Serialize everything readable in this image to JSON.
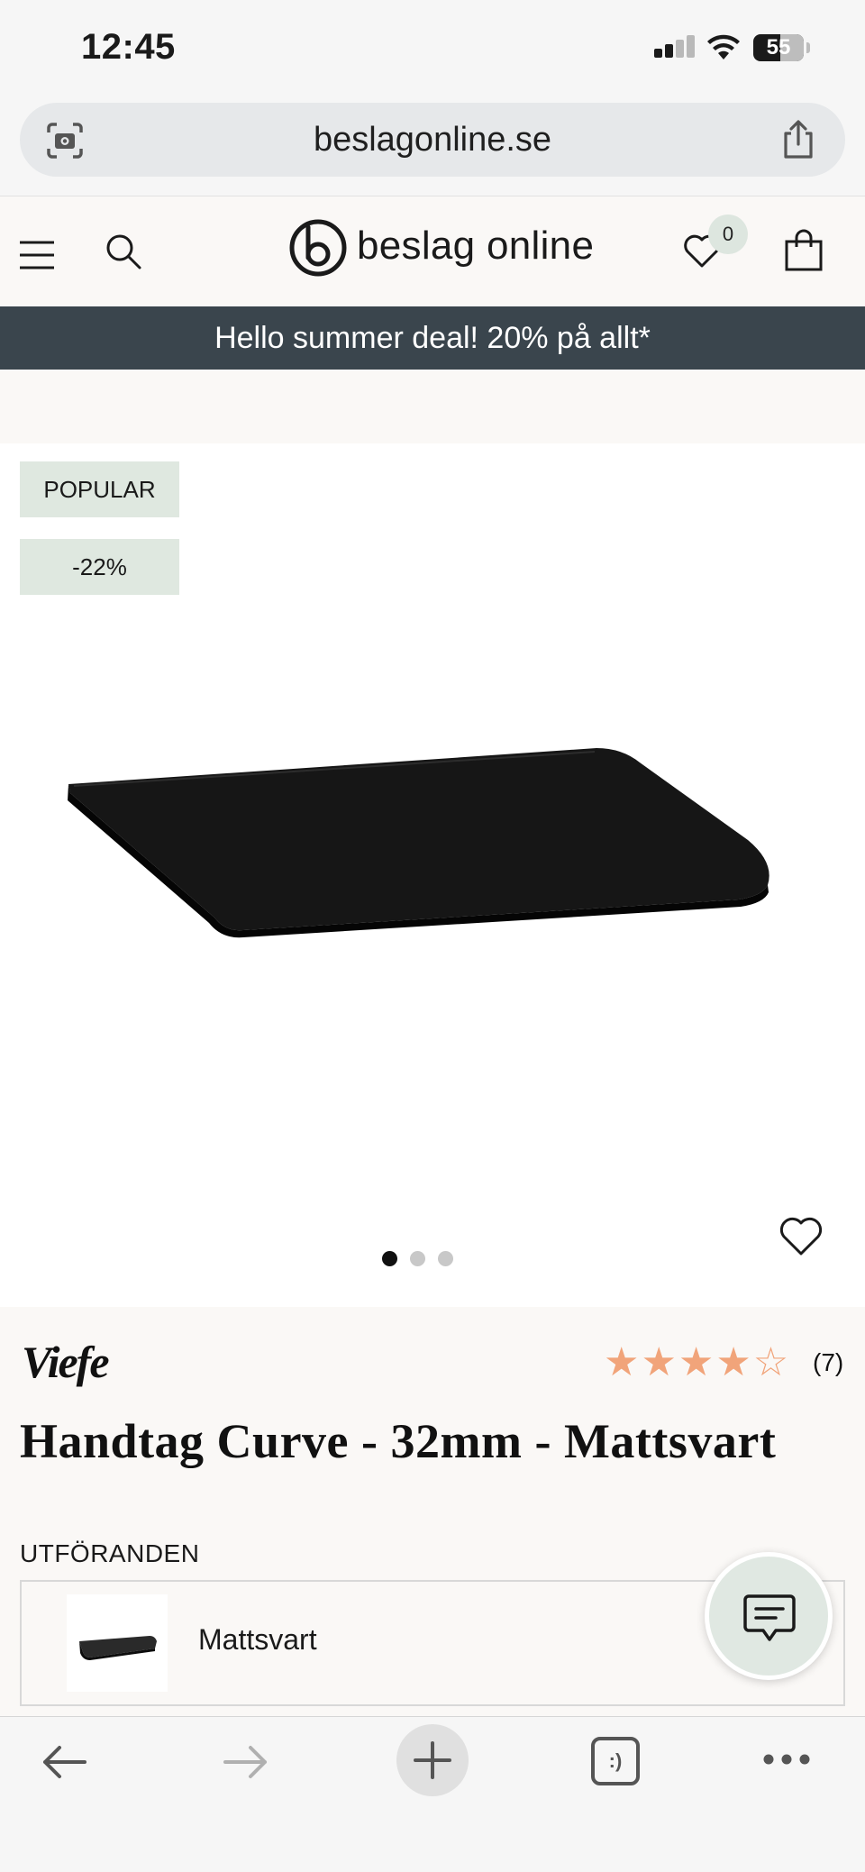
{
  "status_bar": {
    "time": "12:45",
    "battery": "55"
  },
  "browser": {
    "url": "beslagonline.se"
  },
  "header": {
    "logo_text": "beslag online",
    "wishlist_count": "0"
  },
  "promo": {
    "text": "Hello summer deal! 20% på allt*"
  },
  "gallery": {
    "badges": {
      "popular": "POPULAR",
      "discount": "-22%"
    },
    "slide_count": 3,
    "active_slide": 1
  },
  "product": {
    "brand": "Viefe",
    "rating": 4,
    "rating_max": 5,
    "stars_display": "★★★★☆",
    "review_count": "(7)",
    "title": "Handtag Curve - 32mm - Mattsvart"
  },
  "variants": {
    "label": "UTFÖRANDEN",
    "items": [
      {
        "name": "Mattsvart"
      }
    ]
  },
  "colors": {
    "promo_bg": "#3a454d",
    "badge_bg": "#dfe8e0",
    "star": "#f1a47a"
  },
  "icons": {
    "toolbar": [
      "back-arrow-icon",
      "forward-arrow-icon",
      "plus-icon",
      "tabs-icon",
      "more-icon"
    ],
    "tabs_glyph": ":)"
  }
}
